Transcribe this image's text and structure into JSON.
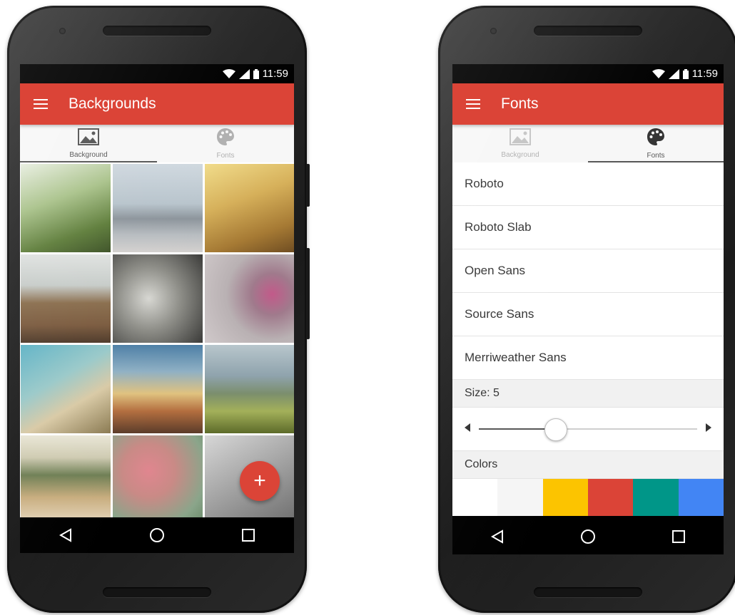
{
  "status_bar": {
    "time": "11:59"
  },
  "left_screen": {
    "title": "Backgrounds",
    "tabs": [
      {
        "label": "Background",
        "icon": "image-icon",
        "active": true
      },
      {
        "label": "Fonts",
        "icon": "palette-icon",
        "active": false
      }
    ],
    "fab_label": "+",
    "thumbnails": [
      "daisies-grass",
      "misty-beach",
      "golden-grass",
      "rocky-shore",
      "grey-flowers",
      "pink-flower",
      "pampas-grass",
      "sunset-beach",
      "green-hills",
      "meadow-field",
      "pink-sprig",
      "grey-grass"
    ]
  },
  "right_screen": {
    "title": "Fonts",
    "tabs": [
      {
        "label": "Background",
        "icon": "image-icon",
        "active": false
      },
      {
        "label": "Fonts",
        "icon": "palette-icon",
        "active": true
      }
    ],
    "fonts": [
      "Roboto",
      "Roboto Slab",
      "Open Sans",
      "Source Sans",
      "Merriweather Sans"
    ],
    "size_label": "Size: 5",
    "size_level": 0.35,
    "colors_label": "Colors",
    "colors": [
      "#ffffff",
      "#f5f5f5",
      "#fcc400",
      "#db4437",
      "#009688",
      "#4285f4"
    ]
  },
  "theme": {
    "accent": "#db4437"
  }
}
